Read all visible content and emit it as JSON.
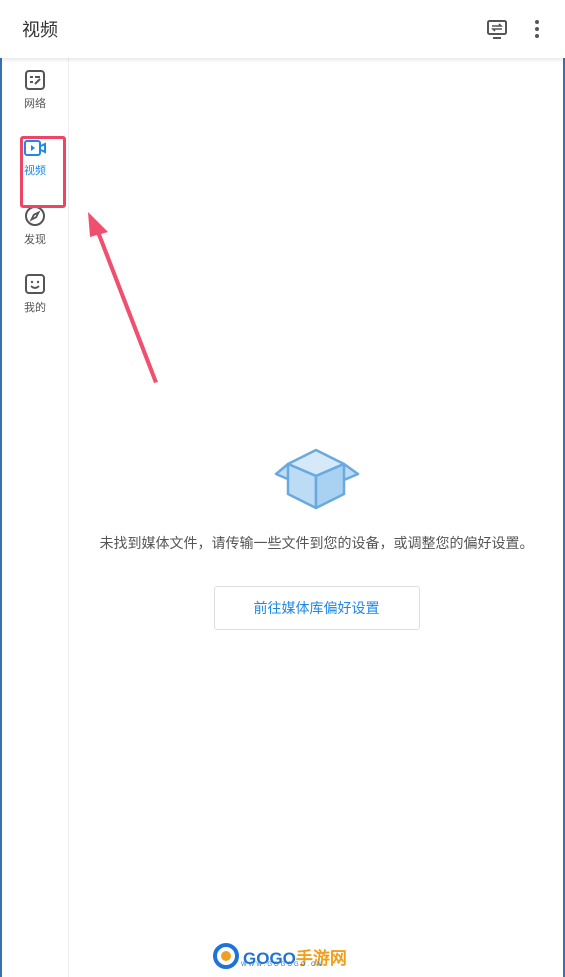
{
  "header": {
    "title": "视频",
    "cast_icon": "cast-screen-icon",
    "more_icon": "more-vertical-icon"
  },
  "sidebar": {
    "items": [
      {
        "label": "网络",
        "icon": "network-list-icon",
        "active": false
      },
      {
        "label": "视频",
        "icon": "video-icon",
        "active": true
      },
      {
        "label": "发现",
        "icon": "compass-icon",
        "active": false
      },
      {
        "label": "我的",
        "icon": "smiley-face-icon",
        "active": false
      }
    ]
  },
  "empty_state": {
    "icon": "open-box-icon",
    "message": "未找到媒体文件，请传输一些文件到您的设备，或调整您的偏好设置。",
    "button_label": "前往媒体库偏好设置"
  },
  "annotation": {
    "highlight_color": "#ee4466"
  },
  "watermark": {
    "text_a": "GOGO",
    "text_b": "手游网",
    "sub": "WWW.GOGOGO.CN"
  },
  "colors": {
    "accent": "#1e88e5",
    "text": "#333333",
    "box_fill": "#bcdcf5",
    "box_stroke": "#6aa9e0"
  }
}
